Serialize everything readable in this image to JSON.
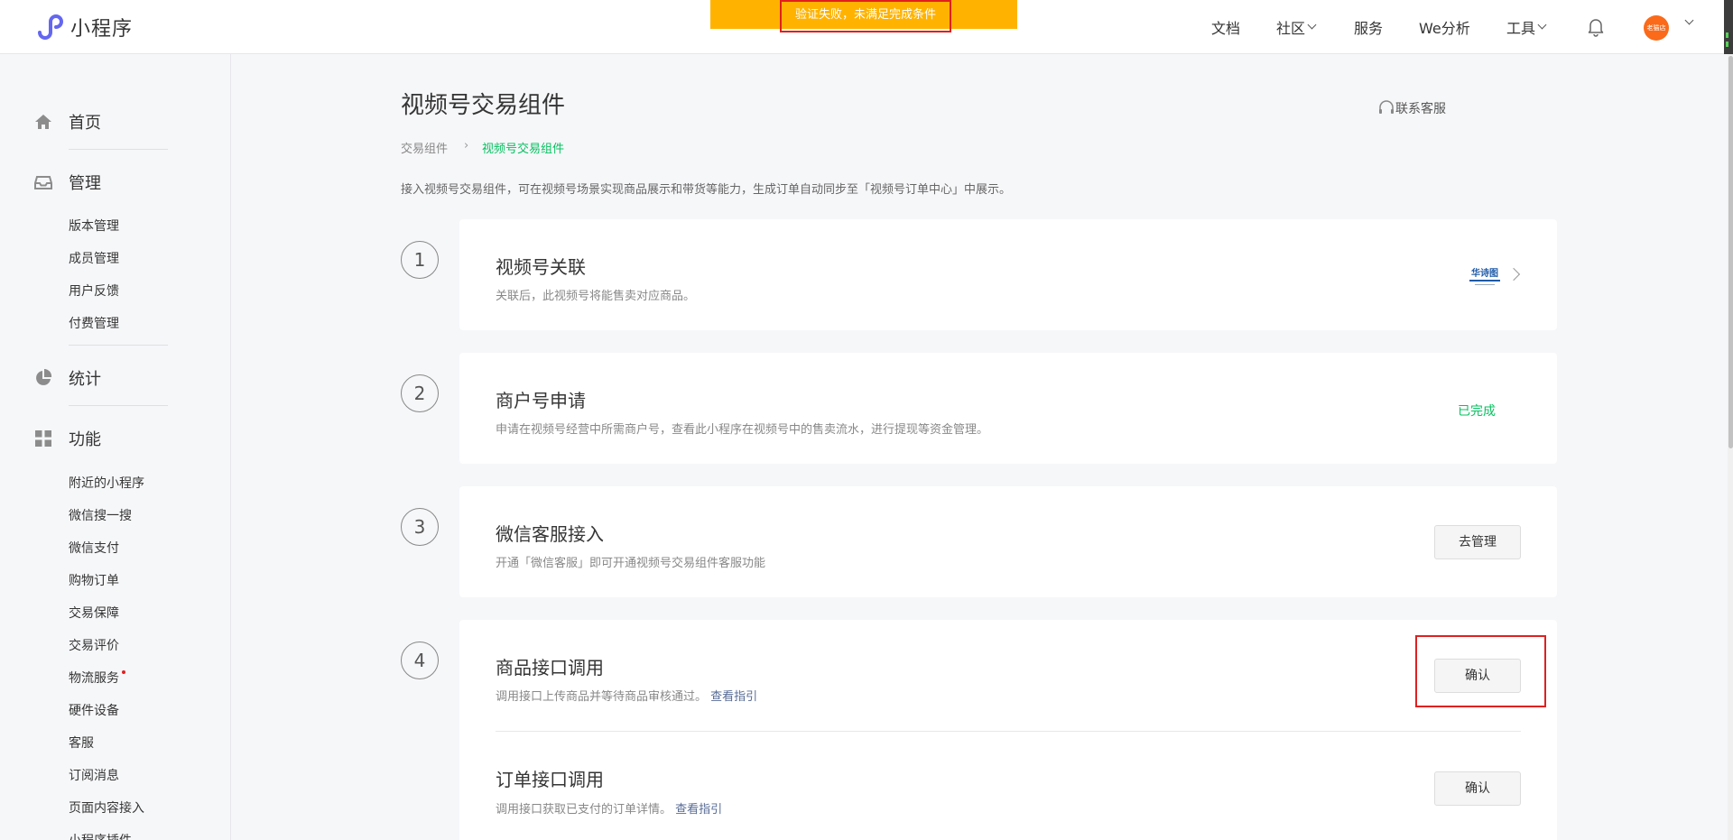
{
  "app": {
    "name": "小程序"
  },
  "toast": {
    "message": "验证失败，未满足完成条件"
  },
  "topnav": {
    "docs": "文档",
    "community": "社区",
    "services": "服务",
    "analytics": "We分析",
    "tools": "工具",
    "avatar_text": "老猫店"
  },
  "sidebar": {
    "home": "首页",
    "manage": "管理",
    "manage_items": [
      "版本管理",
      "成员管理",
      "用户反馈",
      "付费管理"
    ],
    "stats": "统计",
    "features": "功能",
    "feature_items": [
      "附近的小程序",
      "微信搜一搜",
      "微信支付",
      "购物订单",
      "交易保障",
      "交易评价",
      "物流服务",
      "硬件设备",
      "客服",
      "订阅消息",
      "页面内容接入",
      "小程序插件"
    ]
  },
  "main": {
    "title": "视频号交易组件",
    "contact": "联系客服",
    "breadcrumb": [
      "交易组件",
      "视频号交易组件"
    ],
    "description": "接入视频号交易组件，可在视频号场景实现商品展示和带货等能力，生成订单自动同步至「视频号订单中心」中展示。",
    "steps": [
      {
        "num": "1",
        "title": "视频号关联",
        "sub": "关联后，此视频号将能售卖对应商品。",
        "brand": "华诗图"
      },
      {
        "num": "2",
        "title": "商户号申请",
        "sub": "申请在视频号经营中所需商户号，查看此小程序在视频号中的售卖流水，进行提现等资金管理。",
        "status": "已完成"
      },
      {
        "num": "3",
        "title": "微信客服接入",
        "sub": "开通「微信客服」即可开通视频号交易组件客服功能",
        "button": "去管理"
      },
      {
        "num": "4",
        "title": "商品接口调用",
        "sub": "调用接口上传商品并等待商品审核通过。",
        "link": "查看指引",
        "button": "确认"
      },
      {
        "title": "订单接口调用",
        "sub": "调用接口获取已支付的订单详情。",
        "link": "查看指引",
        "button": "确认"
      }
    ]
  },
  "colors": {
    "accent_green": "#07c160",
    "toast_yellow": "#ffb300",
    "highlight_red": "#e02020",
    "link_blue": "#576b95"
  }
}
